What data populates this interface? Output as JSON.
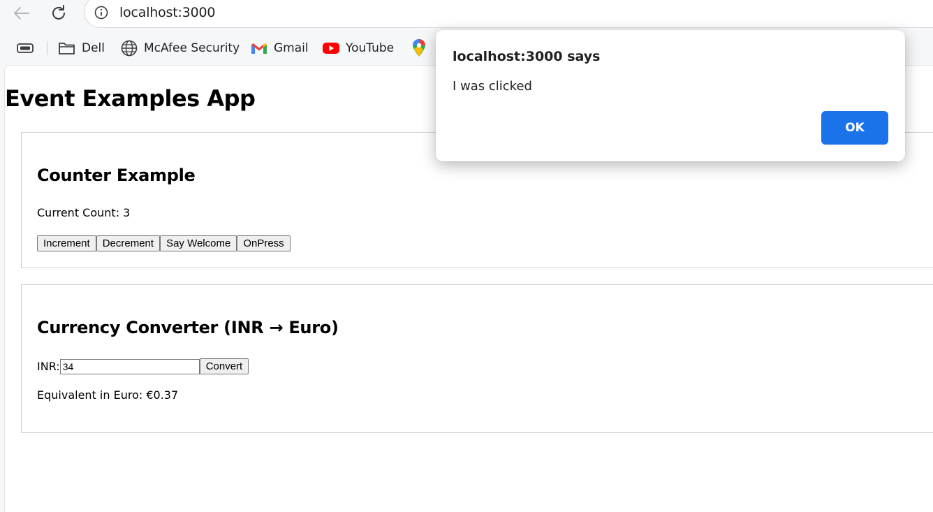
{
  "browser": {
    "url": "localhost:3000",
    "bookmarks": [
      {
        "label": "Dell",
        "icon": "folder-icon"
      },
      {
        "label": "McAfee Security",
        "icon": "globe-icon"
      },
      {
        "label": "Gmail",
        "icon": "gmail-icon"
      },
      {
        "label": "YouTube",
        "icon": "youtube-icon"
      },
      {
        "label": "",
        "icon": "maps-icon"
      }
    ]
  },
  "app": {
    "title": "Event Examples App",
    "counter": {
      "heading": "Counter Example",
      "count_text": "Current Count: 3",
      "buttons": [
        "Increment",
        "Decrement",
        "Say Welcome",
        "OnPress"
      ]
    },
    "converter": {
      "heading": "Currency Converter (INR → Euro)",
      "inr_label": "INR:",
      "inr_value": "34",
      "convert_label": "Convert",
      "result_text": "Equivalent in Euro: €0.37"
    }
  },
  "dialog": {
    "title": "localhost:3000 says",
    "message": "I was clicked",
    "ok_label": "OK"
  },
  "colors": {
    "accent": "#1a73e8",
    "youtube": "#ff0000"
  }
}
